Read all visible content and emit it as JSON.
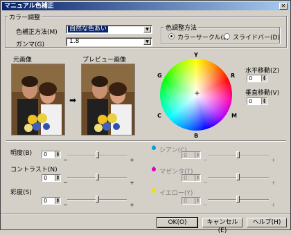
{
  "window": {
    "title": "マニュアル色補正"
  },
  "color_adjust": {
    "group_label": "カラー調整",
    "correction_label": "色補正方法(M)",
    "correction_value": "自然な色あい",
    "gamma_label": "ガンマ(G)",
    "gamma_value": "1.8",
    "method_group_label": "色調整方法",
    "radio_circle_label": "カラーサークル(L)",
    "radio_slider_label": "スライドバー(D)"
  },
  "images": {
    "original_label": "元画像",
    "preview_label": "プレビュー画像"
  },
  "wheel": {
    "labels": {
      "y": "Y",
      "r": "R",
      "m": "M",
      "b": "B",
      "c": "C",
      "g": "G"
    }
  },
  "move": {
    "h_label": "水平移動(Z)",
    "h_value": "0",
    "v_label": "垂直移動(V)",
    "v_value": "0"
  },
  "sliders_left": [
    {
      "label": "明度(B)",
      "value": "0"
    },
    {
      "label": "コントラスト(N)",
      "value": "0"
    },
    {
      "label": "彩度(S)",
      "value": "0"
    }
  ],
  "sliders_right": [
    {
      "label": "シアン(C)",
      "value": "0",
      "color": "#00a0e0"
    },
    {
      "label": "マゼンタ(T)",
      "value": "0",
      "color": "#e000c0"
    },
    {
      "label": "イエロー(Y)",
      "value": "0",
      "color": "#f0e000"
    }
  ],
  "buttons": {
    "ok": "OK(O)",
    "cancel": "キャンセル(E)",
    "help": "ヘルプ(H)"
  }
}
